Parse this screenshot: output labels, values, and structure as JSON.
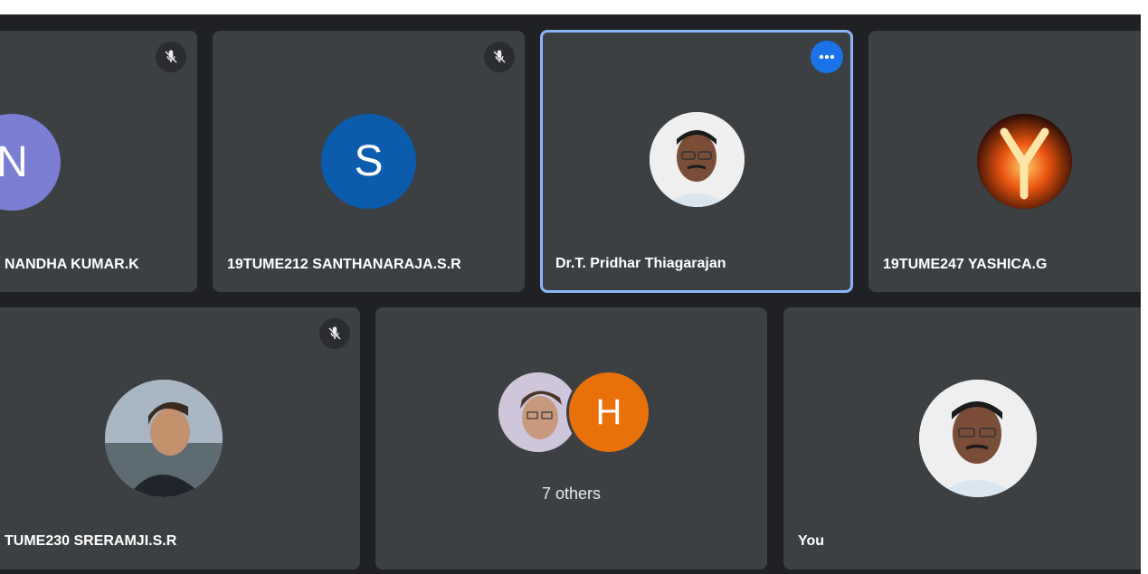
{
  "participants": {
    "t1": {
      "name": "NANDHA KUMAR.K",
      "initial": "N",
      "muted": true,
      "color": "#7b7fd4"
    },
    "t2": {
      "name": "19TUME212 SANTHANARAJA.S.R",
      "initial": "S",
      "muted": true,
      "color": "#0b5cad"
    },
    "t3": {
      "name": "Dr.T. Pridhar Thiagarajan",
      "active": true
    },
    "t4": {
      "name": "19TUME247 YASHICA.G",
      "avatar_letter": "Y"
    },
    "t5": {
      "name": "TUME230 SRERAMJI.S.R",
      "muted": true
    },
    "t6": {
      "others_label": "7 others",
      "initial": "H",
      "color": "#e8710a"
    },
    "t7": {
      "name": "You"
    }
  },
  "icons": {
    "mute": "mic-off-icon",
    "more": "more-options-icon"
  }
}
